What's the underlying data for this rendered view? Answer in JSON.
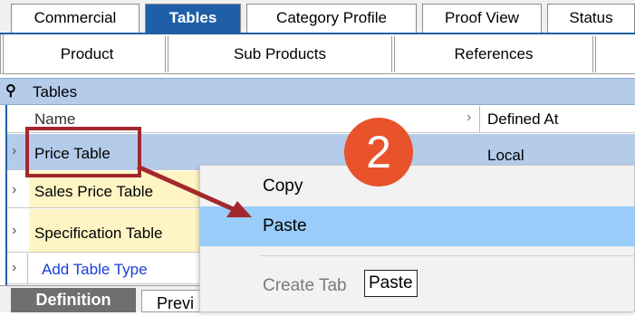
{
  "top_tabs": [
    "Commercial",
    "Tables",
    "Category Profile",
    "Proof View",
    "Status"
  ],
  "sub_tabs": [
    "Product",
    "Sub Products",
    "References"
  ],
  "section": {
    "title": "Tables"
  },
  "grid": {
    "headers": {
      "name": "Name",
      "defined_at": "Defined At"
    },
    "rows": [
      {
        "name": "Price Table",
        "defined_at": "Local"
      },
      {
        "name": "Sales Price Table",
        "defined_at": ""
      },
      {
        "name": "Specification Table",
        "defined_at": ""
      }
    ],
    "add_label": "Add Table Type"
  },
  "bottom_tabs": [
    "Definition",
    "Previ"
  ],
  "context_menu": {
    "items": [
      "Copy",
      "Paste",
      "Create Tab"
    ]
  },
  "tooltip": "Paste",
  "step_badge": "2",
  "colors": {
    "accent": "#1f5fa8",
    "highlight": "#99ccf8",
    "badge": "#e8532b",
    "callout": "#a3282c"
  }
}
